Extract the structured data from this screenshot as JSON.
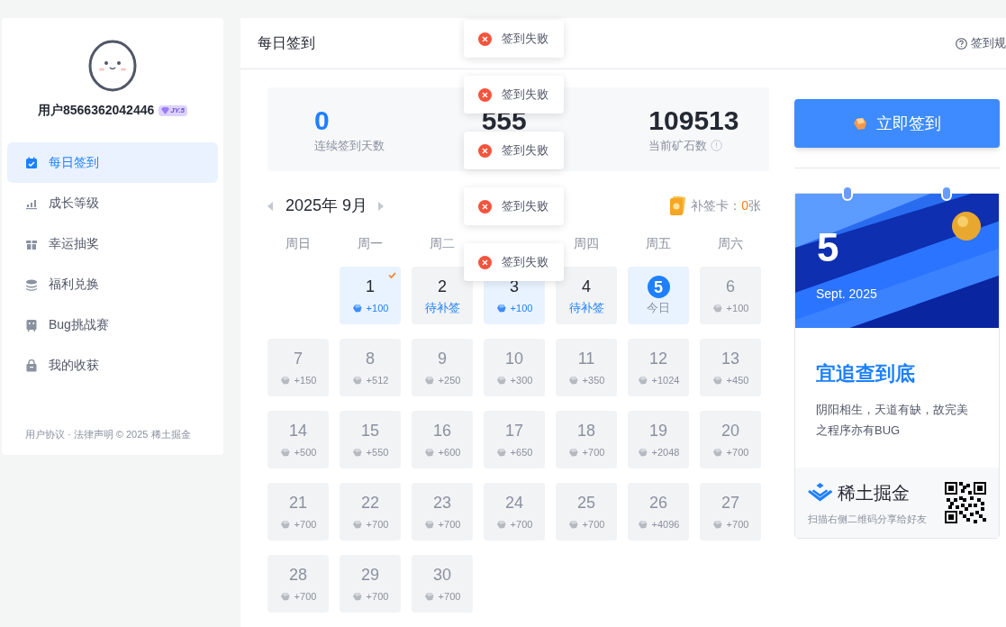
{
  "sidebar": {
    "user": {
      "name": "用户8566362042446",
      "level_badge": "JY.5"
    },
    "items": [
      {
        "label": "每日签到",
        "selected": true
      },
      {
        "label": "成长等级",
        "selected": false
      },
      {
        "label": "幸运抽奖",
        "selected": false
      },
      {
        "label": "福利兑换",
        "selected": false
      },
      {
        "label": "Bug挑战赛",
        "selected": false
      },
      {
        "label": "我的收获",
        "selected": false
      }
    ],
    "footer": "用户协议 · 法律声明 © 2025 稀土掘金"
  },
  "header": {
    "title": "每日签到",
    "help": "签到规"
  },
  "stats": [
    {
      "value": "0",
      "label": "连续签到天数",
      "kind": "primary"
    },
    {
      "value": "555",
      "kind": "plain"
    },
    {
      "value": "109513",
      "label": "当前矿石数",
      "kind": "info"
    }
  ],
  "calendar": {
    "month": "2025年 9月",
    "makeup_label": "补签卡：",
    "makeup_count": "0",
    "makeup_unit": "张",
    "weekdays_before_toast": [
      "周日",
      "周一",
      "周二"
    ],
    "weekdays_after_toast": [
      "周四",
      "周五",
      "周六"
    ],
    "days": [
      {
        "day": "1",
        "kind": "signed_ticked",
        "note": "+100"
      },
      {
        "day": "2",
        "kind": "missed",
        "note": "待补签"
      },
      {
        "day": "3",
        "kind": "signed",
        "note": "+100"
      },
      {
        "day": "4",
        "kind": "missed",
        "note": "待补签"
      },
      {
        "day": "5",
        "kind": "today",
        "note": "今日"
      },
      {
        "day": "6",
        "kind": "future",
        "note": "+100"
      },
      {
        "day": "7",
        "kind": "future",
        "note": "+150"
      },
      {
        "day": "8",
        "kind": "future",
        "note": "+512"
      },
      {
        "day": "9",
        "kind": "future",
        "note": "+250"
      },
      {
        "day": "10",
        "kind": "future",
        "note": "+300"
      },
      {
        "day": "11",
        "kind": "future",
        "note": "+350"
      },
      {
        "day": "12",
        "kind": "future",
        "note": "+1024"
      },
      {
        "day": "13",
        "kind": "future",
        "note": "+450"
      },
      {
        "day": "14",
        "kind": "future",
        "note": "+500"
      },
      {
        "day": "15",
        "kind": "future",
        "note": "+550"
      },
      {
        "day": "16",
        "kind": "future",
        "note": "+600"
      },
      {
        "day": "17",
        "kind": "future",
        "note": "+650"
      },
      {
        "day": "18",
        "kind": "future",
        "note": "+700"
      },
      {
        "day": "19",
        "kind": "future",
        "note": "+2048"
      },
      {
        "day": "20",
        "kind": "future",
        "note": "+700"
      },
      {
        "day": "21",
        "kind": "future",
        "note": "+700"
      },
      {
        "day": "22",
        "kind": "future",
        "note": "+700"
      },
      {
        "day": "23",
        "kind": "future",
        "note": "+700"
      },
      {
        "day": "24",
        "kind": "future",
        "note": "+700"
      },
      {
        "day": "25",
        "kind": "future",
        "note": "+700"
      },
      {
        "day": "26",
        "kind": "future",
        "note": "+4096"
      },
      {
        "day": "27",
        "kind": "future",
        "note": "+700"
      },
      {
        "day": "28",
        "kind": "future",
        "note": "+700"
      },
      {
        "day": "29",
        "kind": "future",
        "note": "+700"
      },
      {
        "day": "30",
        "kind": "future",
        "note": "+700"
      }
    ]
  },
  "sign_button": "立即签到",
  "daily_card": {
    "day": "5",
    "month_year": "Sept. 2025",
    "title": "宜追查到底",
    "text": "阴阳相生，天道有缺，故完美之程序亦有BUG",
    "brand": "稀土掘金",
    "share_hint": "扫描右侧二维码分享给好友"
  },
  "toasts": [
    {
      "text": "签到失败"
    },
    {
      "text": "签到失败"
    },
    {
      "text": "签到失败"
    },
    {
      "text": "签到失败"
    },
    {
      "text": "签到失败"
    }
  ]
}
